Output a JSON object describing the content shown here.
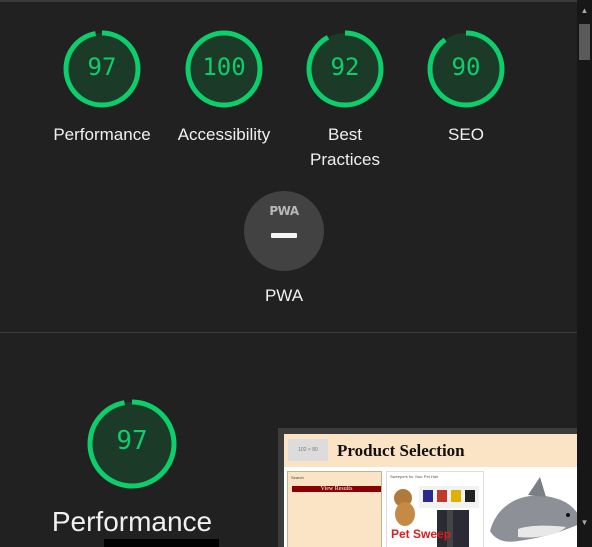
{
  "categories": [
    {
      "label": "Performance",
      "score": "97",
      "value": 97
    },
    {
      "label": "Accessibility",
      "score": "100",
      "value": 100
    },
    {
      "label": "Best Practices",
      "score": "92",
      "value": 92
    },
    {
      "label": "SEO",
      "score": "90",
      "value": 90
    }
  ],
  "pwa": {
    "badge": "PWA",
    "label": "PWA"
  },
  "performance_section": {
    "score": "97",
    "value": 97,
    "title": "Performance"
  },
  "preview": {
    "logo_text": "102 × 80",
    "title": "Product Selection",
    "search_label": "Search",
    "view_results": "View Results",
    "product_caption": "Sweepers for Your Pet Hair",
    "pet_sweep_text": "Pet Sweep"
  },
  "colors": {
    "pass": "#0cce6b",
    "pass_fill": "#1b3a27",
    "background": "#212121"
  }
}
